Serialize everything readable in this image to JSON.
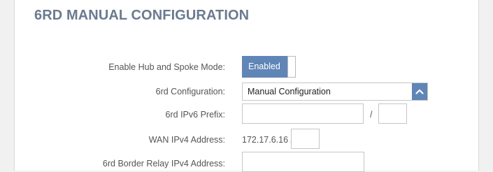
{
  "section": {
    "title": "6RD MANUAL CONFIGURATION"
  },
  "hub_spoke": {
    "label": "Enable Hub and Spoke Mode:",
    "state_label": "Enabled"
  },
  "sixrd_config": {
    "label": "6rd Configuration:",
    "selected": "Manual Configuration"
  },
  "ipv6_prefix": {
    "label": "6rd IPv6 Prefix:",
    "prefix_value": "",
    "separator": "/",
    "length_value": ""
  },
  "wan_ipv4": {
    "label": "WAN IPv4 Address:",
    "address_text": "172.17.6.16 /",
    "mask_value": ""
  },
  "border_relay": {
    "label": "6rd Border Relay IPv4 Address:",
    "value": ""
  },
  "colors": {
    "accent": "#5f86b6",
    "title": "#6a7a8f",
    "label": "#555555"
  },
  "icons": {
    "dropdown": "chevron-up-icon"
  }
}
